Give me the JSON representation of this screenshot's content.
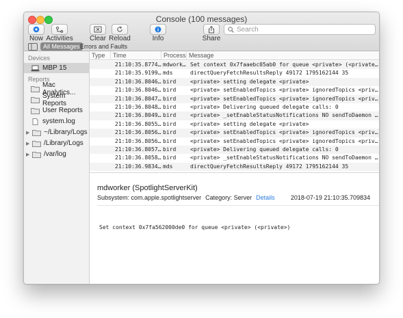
{
  "window": {
    "title": "Console (100 messages)"
  },
  "toolbar": {
    "now_label": "Now",
    "activities_label": "Activities",
    "clear_label": "Clear",
    "reload_label": "Reload",
    "info_label": "Info",
    "share_label": "Share",
    "search_placeholder": "Search"
  },
  "filters": {
    "all_label": "All Messages",
    "errors_label": "Errors and Faults"
  },
  "sidebar": {
    "devices_heading": "Devices",
    "device": "MBP 15",
    "reports_heading": "Reports",
    "reports": [
      "Mac Analytics...",
      "System Reports",
      "User Reports",
      "system.log"
    ],
    "folders": [
      "~/Library/Logs",
      "/Library/Logs",
      "/var/log"
    ]
  },
  "table": {
    "columns": [
      "Type",
      "Time",
      "Process",
      "Message"
    ],
    "rows": [
      {
        "time": "21:10:35.877420",
        "process": "mdwork…",
        "message": "Set context 0x7faaebc05ab0 for queue <private> (<private>)"
      },
      {
        "time": "21:10:35.919926",
        "process": "mds",
        "message": "directQueryFetchResultsReply 49172 1795162144 35"
      },
      {
        "time": "21:10:36.804679",
        "process": "bird",
        "message": "<private> setting delegate <private>"
      },
      {
        "time": "21:10:36.804680",
        "process": "bird",
        "message": "<private> setEnabledTopics <private> ignoredTopics <private> oppo..."
      },
      {
        "time": "21:10:36.804786",
        "process": "bird",
        "message": "<private> setEnabledTopics <private> ignoredTopics <private> oppo..."
      },
      {
        "time": "21:10:36.804867",
        "process": "bird",
        "message": "<private> Delivering queued delegate calls: 0"
      },
      {
        "time": "21:10:36.804912",
        "process": "bird",
        "message": "<private> _setEnableStatusNotifications NO sendToDaemon YES"
      },
      {
        "time": "21:10:36.805563",
        "process": "bird",
        "message": "<private> setting delegate <private>"
      },
      {
        "time": "21:10:36.805616",
        "process": "bird",
        "message": "<private> setEnabledTopics <private> ignoredTopics <private> oppo..."
      },
      {
        "time": "21:10:36.805696",
        "process": "bird",
        "message": "<private> setEnabledTopics <private> ignoredTopics <private> oppo..."
      },
      {
        "time": "21:10:36.805762",
        "process": "bird",
        "message": "<private> Delivering queued delegate calls: 0"
      },
      {
        "time": "21:10:36.805807",
        "process": "bird",
        "message": "<private> _setEnableStatusNotifications NO sendToDaemon YES"
      },
      {
        "time": "21:10:36.983426",
        "process": "mds",
        "message": "directQueryFetchResultsReply 49172 1795162144 35"
      }
    ]
  },
  "detail": {
    "title": "mdworker (SpotlightServerKit)",
    "subsystem": "Subsystem: com.apple.spotlightserver",
    "category": "Category: Server",
    "details_link": "Details",
    "timestamp": "2018-07-19 21:10:35.709834",
    "message": "Set context 0x7fa562000de0 for queue <private> (<private>)"
  },
  "colors": {
    "accent": "#2a7ddf",
    "selected_row": "#d4d4d4"
  }
}
